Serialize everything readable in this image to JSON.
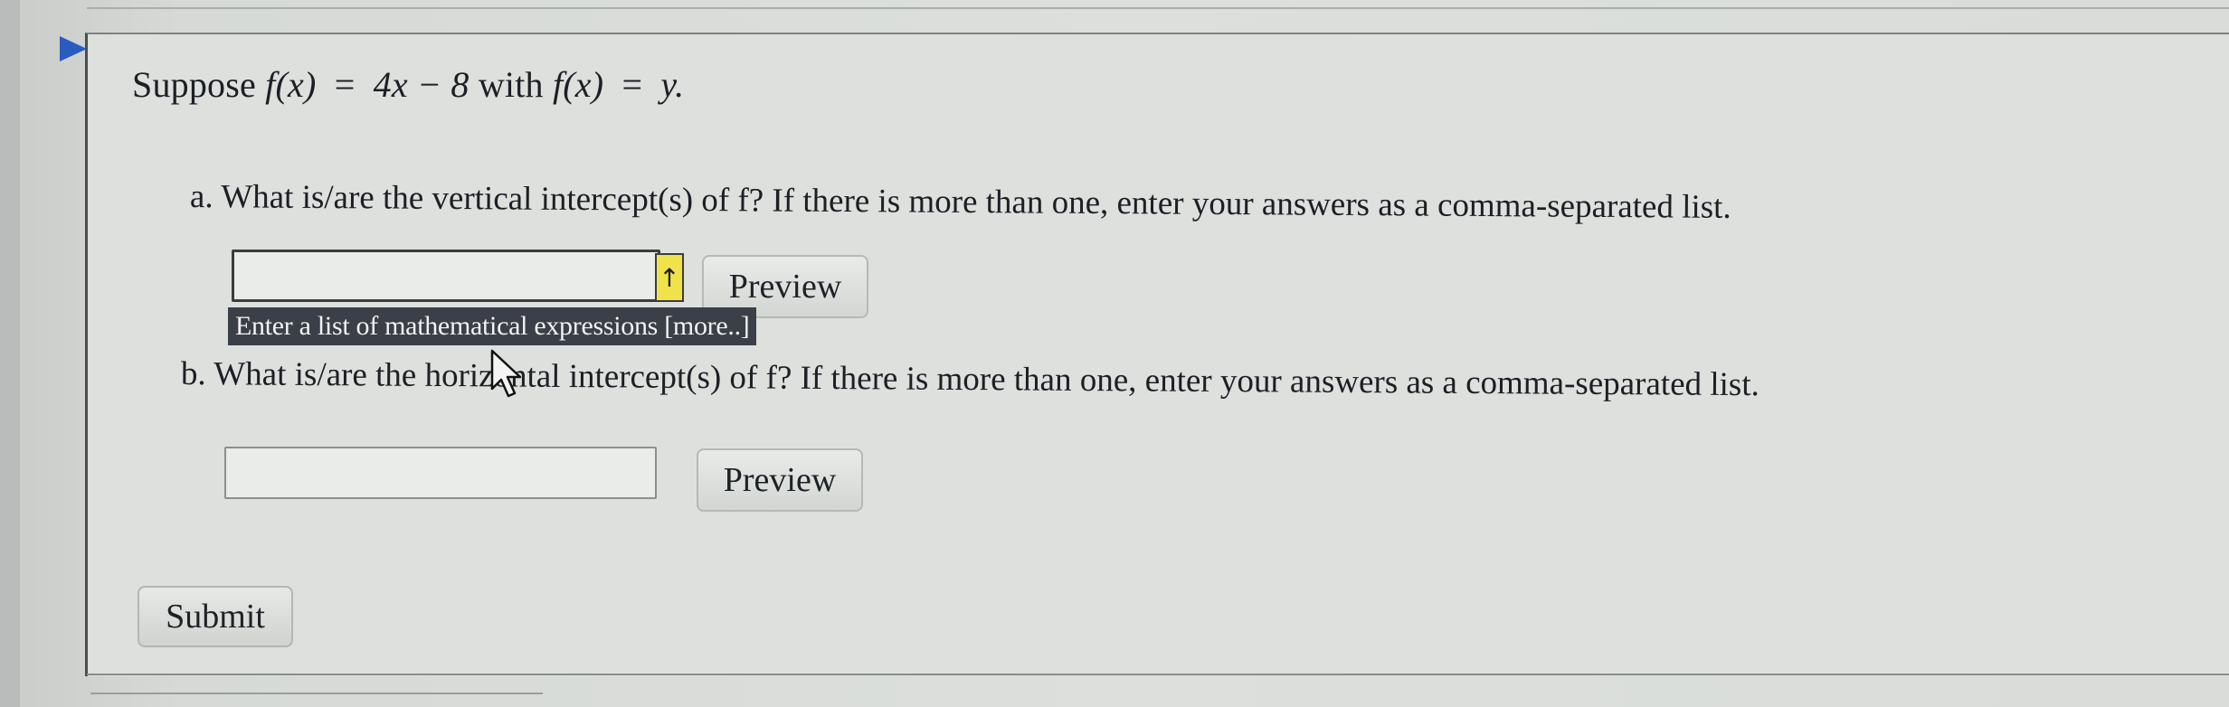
{
  "problem": {
    "stem": {
      "lead": "Suppose",
      "f_of_x": "f(x)",
      "equals": "=",
      "rhs": "4x − 8",
      "with": "with",
      "f_of_x_2": "f(x)",
      "equals_2": "=",
      "y_end": "y."
    },
    "parts": [
      {
        "marker": "a.",
        "question": "What is/are the vertical intercept(s) of f? If there is more than one, enter your answers as a comma-separated list.",
        "input_value": "",
        "preview_label": "Preview",
        "hint": "Enter a list of mathematical expressions",
        "hint_more": "[more..]",
        "badge_icon": "up-arrow"
      },
      {
        "marker": "b.",
        "question": "What is/are the horizontal intercept(s) of f? If there is more than one, enter your answers as a comma-separated list.",
        "input_value": "",
        "preview_label": "Preview"
      }
    ],
    "submit_label": "Submit"
  },
  "colors": {
    "arrow": "#2a5bbf",
    "badge": "#f0e24a",
    "hint_bg": "#3a3f48"
  }
}
